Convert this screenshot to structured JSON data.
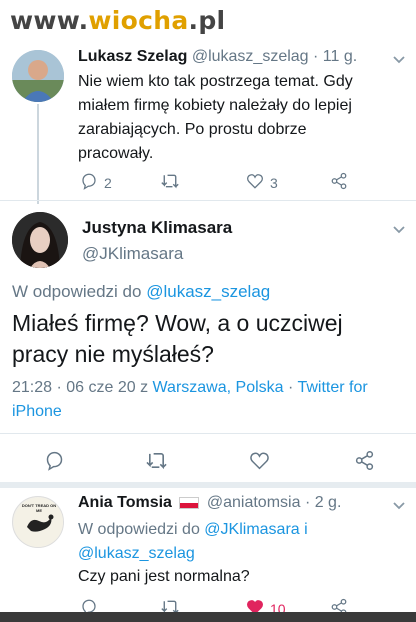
{
  "watermark": {
    "prefix": "www.",
    "accent": "wiocha",
    "suffix": ".pl"
  },
  "reply1": {
    "name": "Lukasz Szelag",
    "handle": "@lukasz_szelag",
    "time": "· 11 g.",
    "text_lines": [
      "Nie wiem kto tak postrzega temat. Gdy",
      "miałem firmę kobiety należały do lepiej",
      "zarabiających. Po prostu dobrze",
      "pracowały."
    ],
    "reply_count": "2",
    "like_count": "3"
  },
  "main": {
    "name": "Justyna Klimasara",
    "handle": "@JKlimasara",
    "reply_to_prefix": "W odpowiedzi do",
    "reply_to_handle": "@lukasz_szelag",
    "text_lines": [
      "Miałeś firmę? Wow, a o uczciwej",
      "pracy nie myślałeś?"
    ],
    "time": "21:28 · 06 cze 20 z",
    "location": "Warszawa, Polska",
    "source_sep": "·",
    "source_line1": "Twitter for",
    "source_line2": "iPhone"
  },
  "reply2": {
    "name": "Ania Tomsia",
    "handle": "@aniatomsia",
    "time": "· 2 g.",
    "reply_to_prefix": "W odpowiedzi do",
    "reply_to_handle1": "@JKlimasara",
    "reply_to_and": "i",
    "reply_to_handle2": "@lukasz_szelag",
    "text": "Czy pani jest normalna?",
    "like_count": "10",
    "avatar_text": "DON'T TREAD ON ME"
  },
  "colors": {
    "link": "#1b95e0",
    "muted": "#657786",
    "like": "#e0245e",
    "flag_red": "#dc143c"
  },
  "icons": [
    "reply-icon",
    "retweet-icon",
    "like-icon",
    "share-icon"
  ]
}
